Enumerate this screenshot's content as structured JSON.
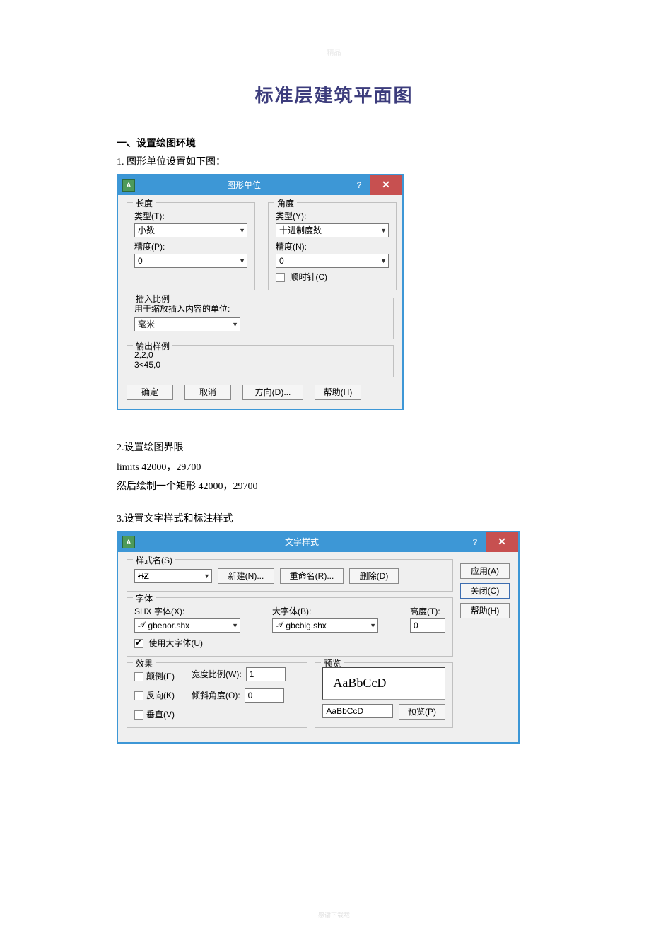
{
  "watermark_top": "精品",
  "watermark_bottom": "感谢下载载",
  "title": "标准层建筑平面图",
  "sec1_h": "一、设置绘图环境",
  "sec1_p1": "1. 图形单位设置如下图：",
  "dialog1": {
    "title": "图形单位",
    "help_glyph": "?",
    "close_glyph": "✕",
    "length_label": "长度",
    "type_label_l": "类型(T):",
    "type_val_l": "小数",
    "precision_label_l": "精度(P):",
    "precision_val_l": "0",
    "angle_label": "角度",
    "type_label_a": "类型(Y):",
    "type_val_a": "十进制度数",
    "precision_label_a": "精度(N):",
    "precision_val_a": "0",
    "clockwise_label": "顺时针(C)",
    "insert_label": "插入比例",
    "insert_desc": "用于缩放插入内容的单位:",
    "insert_val": "毫米",
    "output_label": "输出样例",
    "output_l1": "2,2,0",
    "output_l2": "3<45,0",
    "btn_ok": "确定",
    "btn_cancel": "取消",
    "btn_direction": "方向(D)...",
    "btn_help": "帮助(H)"
  },
  "sec2_p1": "2.设置绘图界限",
  "sec2_p2": "limits  42000，29700",
  "sec2_p3": "然后绘制一个矩形 42000，29700",
  "sec3_p1": "3.设置文字样式和标注样式",
  "dialog2": {
    "title": "文字样式",
    "help_glyph": "?",
    "close_glyph": "✕",
    "stylename_label": "样式名(S)",
    "stylename_val": "HZ",
    "btn_new": "新建(N)...",
    "btn_rename": "重命名(R)...",
    "btn_delete": "删除(D)",
    "btn_apply": "应用(A)",
    "btn_close": "关闭(C)",
    "btn_help": "帮助(H)",
    "font_label": "字体",
    "shxfont_label": "SHX 字体(X):",
    "shxfont_val": "gbenor.shx",
    "bigfont_label": "大字体(B):",
    "bigfont_val": "gbcbig.shx",
    "height_label": "高度(T):",
    "height_val": "0",
    "usebigfont_label": "使用大字体(U)",
    "effects_label": "效果",
    "upsidedown_label": "颠倒(E)",
    "backwards_label": "反向(K)",
    "vertical_label": "垂直(V)",
    "widthfactor_label": "宽度比例(W):",
    "widthfactor_val": "1",
    "oblique_label": "倾斜角度(O):",
    "oblique_val": "0",
    "preview_label": "预览",
    "preview_text": "AaBbCcD",
    "preview_edit_val": "AaBbCcD",
    "btn_preview": "预览(P)"
  }
}
